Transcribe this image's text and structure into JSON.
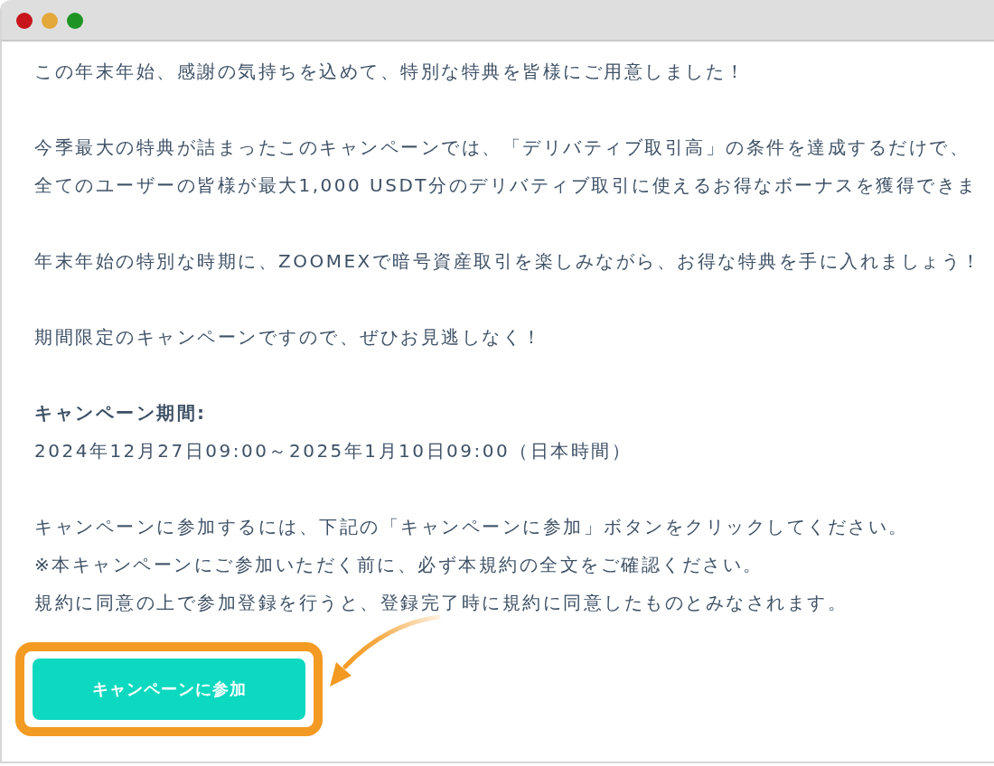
{
  "window": {
    "controls": [
      {
        "color": "#c8151b"
      },
      {
        "color": "#e3a73a"
      },
      {
        "color": "#1d9424"
      }
    ]
  },
  "content": [
    {
      "kind": "text",
      "lines": [
        "この年末年始、感謝の気持ちを込めて、特別な特典を皆様にご用意しました！"
      ]
    },
    {
      "kind": "text",
      "lines": [
        "今季最大の特典が詰まったこのキャンペーンでは、「デリバティブ取引高」の条件を達成するだけで、",
        "全てのユーザーの皆様が最大1,000 USDT分のデリバティブ取引に使えるお得なボーナスを獲得できま"
      ]
    },
    {
      "kind": "text",
      "lines": [
        "年末年始の特別な時期に、ZOOMEXで暗号資産取引を楽しみながら、お得な特典を手に入れましょう！"
      ]
    },
    {
      "kind": "text",
      "lines": [
        "期間限定のキャンペーンですので、ぜひお見逃しなく！"
      ]
    },
    {
      "kind": "labeled",
      "label": "キャンペーン期間:",
      "lines": [
        "2024年12月27日09:00～2025年1月10日09:00（日本時間）"
      ]
    },
    {
      "kind": "text",
      "lines": [
        "キャンペーンに参加するには、下記の「キャンペーンに参加」ボタンをクリックしてください。",
        "※本キャンペーンにご参加いただく前に、必ず本規約の全文をご確認ください。",
        "規約に同意の上で参加登録を行うと、登録完了時に規約に同意したものとみなされます。"
      ]
    }
  ],
  "cta": {
    "label": "キャンペーンに参加",
    "highlighted": true
  }
}
